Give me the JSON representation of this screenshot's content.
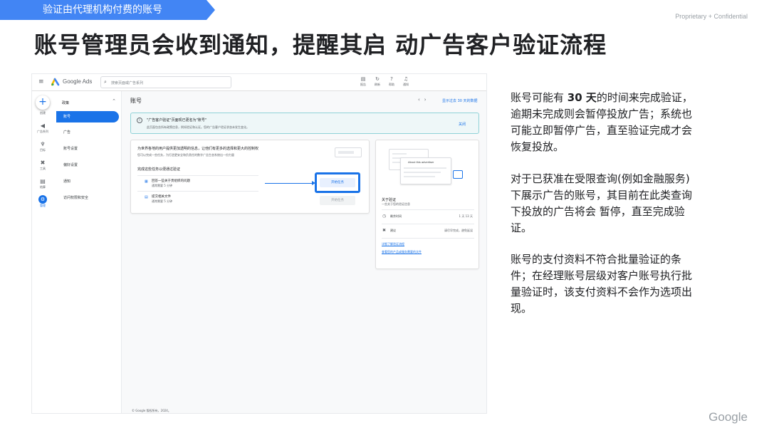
{
  "slide": {
    "tag": "验证由代理机构付费的账号",
    "proprietary": "Proprietary + Confidential",
    "title": "账号管理员会收到通知，提醒其启 动广告客户验证流程",
    "logo": "Google"
  },
  "right_text": {
    "p1_a": "账号可能有 ",
    "p1_b": "30 天",
    "p1_c": "的时间来完成验证，逾期未完成则会暂停投放广告；系统也可能立即暂停广告，直至验证完成才会恢复投放。",
    "p2": "对于已获准在受限查询(例如金融服务)下展示广告的账号，其目前在此类查询下投放的广告将会 暂停，直至完成验证。",
    "p3": "账号的支付资料不符合批量验证的条件；在经理账号层级对客户账号执行批量验证时，该支付资料不会作为选项出现。"
  },
  "ads": {
    "brand": "Google Ads",
    "search_placeholder": "搜索页面或广告系列",
    "top_icons": [
      {
        "icon": "report-icon",
        "glyph": "▤",
        "label": "报告"
      },
      {
        "icon": "refresh-icon",
        "glyph": "↻",
        "label": "刷新"
      },
      {
        "icon": "help-icon",
        "glyph": "?",
        "label": "帮助"
      },
      {
        "icon": "bell-icon",
        "glyph": "♫",
        "label": "通知"
      }
    ],
    "rail": {
      "create_label": "创建",
      "items": [
        {
          "glyph": "◀",
          "label": "广告系列"
        },
        {
          "glyph": "♆",
          "label": "目标"
        },
        {
          "glyph": "✖",
          "label": "工具"
        },
        {
          "glyph": "▤",
          "label": "结算"
        },
        {
          "glyph": "⚙",
          "label": "管理"
        }
      ]
    },
    "nav": {
      "section": "政策",
      "items": [
        "账号",
        "广告",
        "账号设置",
        "偏好设置",
        "通知",
        "访问权限和安全"
      ]
    },
    "content": {
      "title": "账号",
      "period_link": "显示过去 30 天的数据",
      "notice": {
        "title": "\"广告客户验证\"页面现已更名为\"账号\"",
        "body": "此页面包含所有政策信息，例如验证和认证。您的广告客户验证状态未发生变化。",
        "link": "关闭"
      },
      "main_card": {
        "heading": "为世界各地的用户提供更加透明的信息，让他们有更多的选择和更大的控制权",
        "sub": "您可以完成一些任务，为打造更安全和负责任的数字广告生态系统出一份力量",
        "section": "完成这些任务以便通过验证",
        "tasks": [
          {
            "title": "回答一些关于贵组织的问题",
            "sub": "通常需要 5 分钟"
          },
          {
            "title": "提交相关文件",
            "sub": "通常需要 5 分钟"
          }
        ],
        "start_button": "开始任务",
        "next_button": "开始任务"
      },
      "side_card": {
        "illu_title": "About this advertiser",
        "heading": "关于验证",
        "sub": "一些关于您的验证信息",
        "rows": [
          {
            "icon": "clock-icon",
            "glyph": "◷",
            "label": "剩余时间",
            "value": "1 天 13 天"
          },
          {
            "icon": "tools-icon",
            "glyph": "✖",
            "label": "建议",
            "value": "请尽早完成，避免延误"
          }
        ],
        "links": [
          "详细了解验证流程",
          "查看您的产品或服务需要的文件"
        ]
      },
      "footer": "© Google 版权所有，2024。"
    }
  }
}
